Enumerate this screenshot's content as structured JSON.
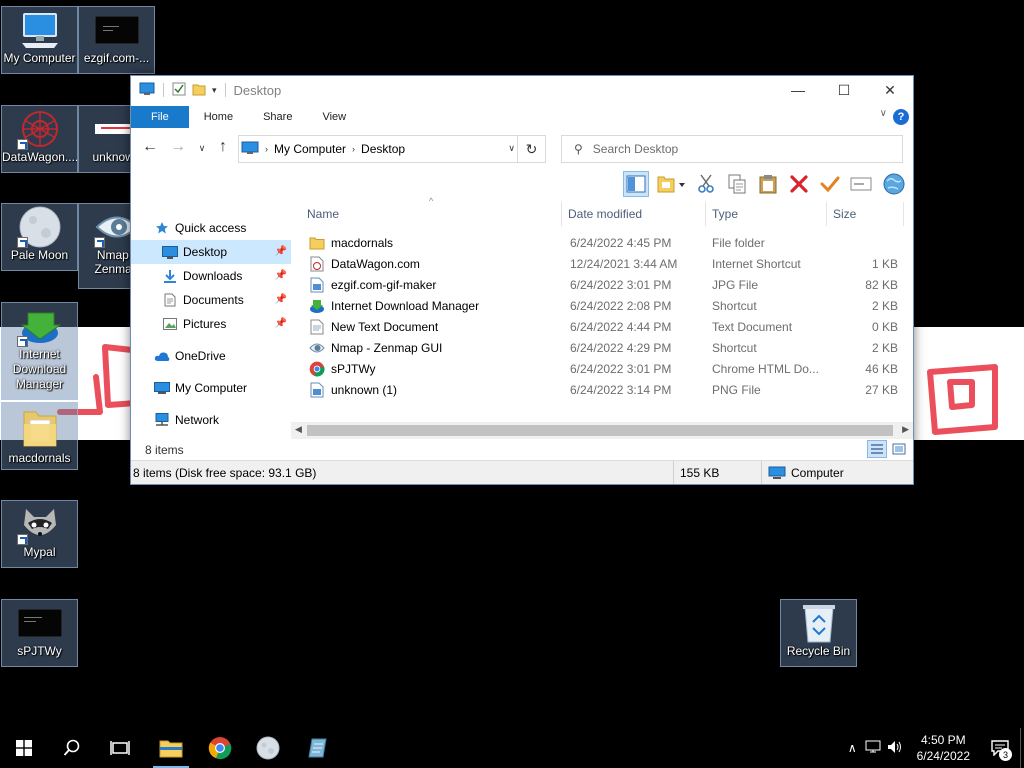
{
  "desktop": {
    "icons": [
      {
        "label": "My Computer"
      },
      {
        "label": "ezgif.com-..."
      },
      {
        "label": "DataWagon...."
      },
      {
        "label": "unknown"
      },
      {
        "label": "Pale Moon"
      },
      {
        "label": "Nmap - Zenmap"
      },
      {
        "label": "Internet Download Manager"
      },
      {
        "label": "macdornals"
      },
      {
        "label": "Mypal"
      },
      {
        "label": "sPJTWy"
      },
      {
        "label": "Recycle Bin"
      }
    ]
  },
  "window": {
    "title": "Desktop",
    "controls": {
      "minimize": "—",
      "maximize": "☐",
      "close": "✕"
    },
    "ribbon_tabs": [
      "File",
      "Home",
      "Share",
      "View"
    ],
    "help": "?",
    "address": {
      "root": "My Computer",
      "current": "Desktop"
    },
    "search": {
      "placeholder": "Search Desktop"
    },
    "nav": {
      "quick_access": "Quick access",
      "pinned": [
        "Desktop",
        "Downloads",
        "Documents",
        "Pictures"
      ],
      "onedrive": "OneDrive",
      "my_computer": "My Computer",
      "network": "Network"
    },
    "columns": [
      "Name",
      "Date modified",
      "Type",
      "Size"
    ],
    "files": [
      {
        "name": "macdornals",
        "date": "6/24/2022 4:45 PM",
        "type": "File folder",
        "size": "",
        "icon": "folder-icon"
      },
      {
        "name": "DataWagon.com",
        "date": "12/24/2021 3:44 AM",
        "type": "Internet Shortcut",
        "size": "1 KB",
        "icon": "internet-shortcut-icon"
      },
      {
        "name": "ezgif.com-gif-maker",
        "date": "6/24/2022 3:01 PM",
        "type": "JPG File",
        "size": "82 KB",
        "icon": "image-file-icon"
      },
      {
        "name": "Internet Download Manager",
        "date": "6/24/2022 2:08 PM",
        "type": "Shortcut",
        "size": "2 KB",
        "icon": "idm-icon"
      },
      {
        "name": "New Text Document",
        "date": "6/24/2022 4:44 PM",
        "type": "Text Document",
        "size": "0 KB",
        "icon": "text-file-icon"
      },
      {
        "name": "Nmap - Zenmap GUI",
        "date": "6/24/2022 4:29 PM",
        "type": "Shortcut",
        "size": "2 KB",
        "icon": "zenmap-icon"
      },
      {
        "name": "sPJTWy",
        "date": "6/24/2022 3:01 PM",
        "type": "Chrome HTML Do...",
        "size": "46 KB",
        "icon": "chrome-icon"
      },
      {
        "name": "unknown (1)",
        "date": "6/24/2022 3:14 PM",
        "type": "PNG File",
        "size": "27 KB",
        "icon": "image-file-icon"
      }
    ],
    "item_count": "8 items",
    "status": {
      "left": "8 items (Disk free space: 93.1 GB)",
      "size": "155 KB",
      "location": "Computer"
    }
  },
  "taskbar": {
    "clock_time": "4:50 PM",
    "clock_date": "6/24/2022",
    "notifications": "3"
  },
  "colors": {
    "accent": "#1979ca",
    "selection": "#cce8ff",
    "wallpaper_mark": "#e8313f"
  }
}
